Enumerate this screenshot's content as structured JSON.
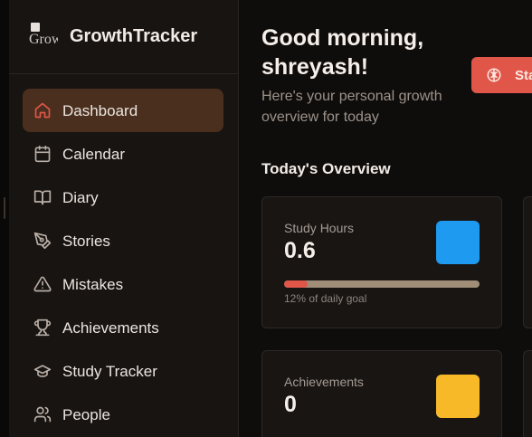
{
  "brand": {
    "name": "GrowthTracker",
    "logo_alt": "Grow"
  },
  "sidebar": {
    "items": [
      {
        "label": "Dashboard",
        "icon": "home-icon",
        "active": true
      },
      {
        "label": "Calendar",
        "icon": "calendar-icon",
        "active": false
      },
      {
        "label": "Diary",
        "icon": "book-open-icon",
        "active": false
      },
      {
        "label": "Stories",
        "icon": "pen-tool-icon",
        "active": false
      },
      {
        "label": "Mistakes",
        "icon": "alert-triangle-icon",
        "active": false
      },
      {
        "label": "Achievements",
        "icon": "trophy-icon",
        "active": false
      },
      {
        "label": "Study Tracker",
        "icon": "graduation-cap-icon",
        "active": false
      },
      {
        "label": "People",
        "icon": "users-icon",
        "active": false
      }
    ]
  },
  "header": {
    "greeting": "Good morning, shreyash!",
    "subtitle": "Here's your personal growth overview for today",
    "start_button": {
      "label": "Sta",
      "icon": "brain-icon"
    }
  },
  "overview": {
    "title": "Today's Overview",
    "cards": [
      {
        "label": "Study Hours",
        "value": "0.6",
        "color": "#1e9bf0",
        "progress": 0.12,
        "note": "12% of daily goal"
      },
      {
        "label": "Achievements",
        "value": "0",
        "color": "#f7b928"
      }
    ]
  },
  "colors": {
    "accent": "#e0574a",
    "active_nav": "#4a2f1e",
    "study_swatch": "#1e9bf0",
    "achievement_swatch": "#f7b928",
    "progress_track": "#a08e79"
  }
}
